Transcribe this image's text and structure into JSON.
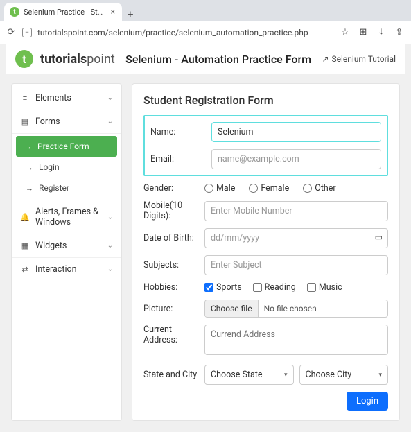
{
  "browser": {
    "tab_title": "Selenium Practice - Student R",
    "url": "tutorialspoint.com/selenium/practice/selenium_automation_practice.php"
  },
  "header": {
    "brand_prefix": "tutorials",
    "brand_suffix": "point",
    "title": "Selenium - Automation Practice Form",
    "tutorial_link": "Selenium Tutorial"
  },
  "sidebar": {
    "elements": "Elements",
    "forms": "Forms",
    "practice_form": "Practice Form",
    "login": "Login",
    "register": "Register",
    "alerts": "Alerts, Frames & Windows",
    "widgets": "Widgets",
    "interaction": "Interaction"
  },
  "form": {
    "title": "Student Registration Form",
    "labels": {
      "name": "Name:",
      "email": "Email:",
      "gender": "Gender:",
      "mobile": "Mobile(10 Digits):",
      "dob": "Date of Birth:",
      "subjects": "Subjects:",
      "hobbies": "Hobbies:",
      "picture": "Picture:",
      "address": "Current Address:",
      "statecity": "State and City"
    },
    "values": {
      "name": "Selenium"
    },
    "placeholders": {
      "email": "name@example.com",
      "mobile": "Enter Mobile Number",
      "dob": "dd/mm/yyyy",
      "subjects": "Enter Subject",
      "address": "Currend Address"
    },
    "gender": {
      "male": "Male",
      "female": "Female",
      "other": "Other"
    },
    "hobbies": {
      "sports": "Sports",
      "reading": "Reading",
      "music": "Music"
    },
    "file": {
      "button": "Choose file",
      "status": "No file chosen"
    },
    "state": "Choose State",
    "city": "Choose City",
    "submit": "Login"
  }
}
